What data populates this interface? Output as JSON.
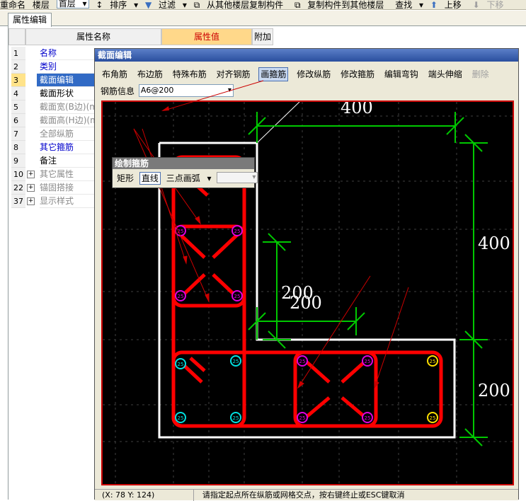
{
  "toolbar": {
    "rename": "重命名",
    "floor_label": "楼层",
    "floor_value": "首层",
    "sort": "排序",
    "filter": "过滤",
    "copy_from": "从其他楼层复制构件",
    "copy_to": "复制构件到其他楼层",
    "find": "查找",
    "move_up": "上移",
    "move_down": "下移"
  },
  "tabs": {
    "active": "属性编辑"
  },
  "grid": {
    "header_name": "属性名称",
    "header_value": "属性值",
    "header_extra": "附加",
    "rows": [
      {
        "num": "1",
        "name": "名称"
      },
      {
        "num": "2",
        "name": "类别"
      },
      {
        "num": "3",
        "name": "截面编辑"
      },
      {
        "num": "4",
        "name": "截面形状"
      },
      {
        "num": "5",
        "name": "截面宽(B边)(m"
      },
      {
        "num": "6",
        "name": "截面高(H边)(m"
      },
      {
        "num": "7",
        "name": "全部纵筋"
      },
      {
        "num": "8",
        "name": "其它箍筋"
      },
      {
        "num": "9",
        "name": "备注"
      },
      {
        "num": "10",
        "name": "其它属性",
        "expander": "+"
      },
      {
        "num": "22",
        "name": "锚固搭接",
        "expander": "+"
      },
      {
        "num": "37",
        "name": "显示样式",
        "expander": "+"
      }
    ]
  },
  "dialog": {
    "title": "截面编辑",
    "tools": [
      "布角筋",
      "布边筋",
      "特殊布筋",
      "对齐钢筋",
      "画箍筋",
      "修改纵筋",
      "修改箍筋",
      "编辑弯钩",
      "端头伸缩",
      "删除"
    ],
    "rebar_info_label": "钢筋信息",
    "rebar_info_value": "A6@200",
    "status_coord": "(X: 78 Y: 124)",
    "status_msg": "请指定起点所在纵筋或网格交点，按右键终止或ESC键取消"
  },
  "draw_panel": {
    "title": "绘制箍筋",
    "rect": "矩形",
    "line": "直线",
    "arc": "三点画弧"
  },
  "drawing": {
    "dim_top": "400",
    "dim_right_upper": "400",
    "dim_right_lower": "200",
    "dim_inner_a": "200",
    "dim_inner_b": "200",
    "bar_label": "25",
    "colors": {
      "background": "#000000",
      "stirrup": "#FF0000",
      "outline": "#FFFFFF",
      "dimension": "#00C800",
      "arrow": "#CC0000"
    }
  }
}
